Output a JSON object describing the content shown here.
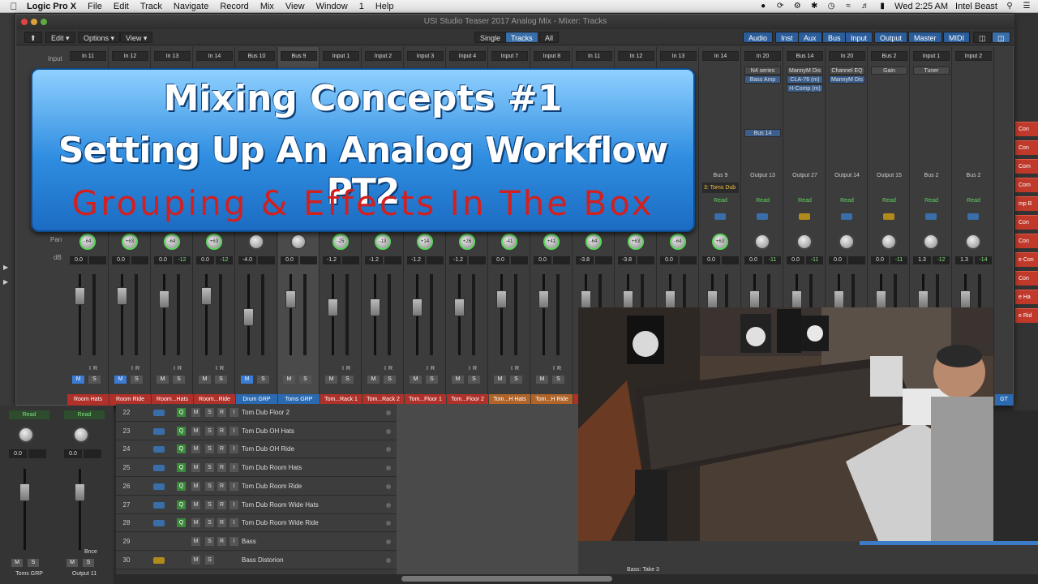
{
  "menubar": {
    "app": "Logic Pro X",
    "items": [
      "File",
      "Edit",
      "Track",
      "Navigate",
      "Record",
      "Mix",
      "View",
      "Window",
      "1",
      "Help"
    ],
    "clock": "Wed 2:25 AM",
    "user": "Intel Beast"
  },
  "window": {
    "title": "USI Studio Teaser 2017 Analog Mix - Mixer: Tracks"
  },
  "toolbar": {
    "edit": "Edit",
    "options": "Options",
    "view": "View",
    "single": "Single",
    "tracks": "Tracks",
    "all": "All",
    "filters": [
      "Audio",
      "Inst",
      "Aux",
      "Bus",
      "Input",
      "Output",
      "Master",
      "MIDI"
    ]
  },
  "row_labels": {
    "input": "Input",
    "pan": "Pan",
    "db": "dB"
  },
  "strips": [
    {
      "input": "In 11",
      "pan": "-64",
      "db": "0.0",
      "peak": "",
      "name": "Room Hats",
      "color": "#b0312a",
      "mute": true,
      "ir": true
    },
    {
      "input": "In 12",
      "pan": "+63",
      "db": "0.0",
      "peak": "",
      "name": "Room Ride",
      "color": "#b0312a",
      "mute": true,
      "ir": true
    },
    {
      "input": "In 13",
      "pan": "-64",
      "db": "0.0",
      "peak": "-12",
      "name": "Room...Hats",
      "color": "#b0312a",
      "mute": false,
      "ir": true
    },
    {
      "input": "In 14",
      "pan": "+63",
      "db": "0.0",
      "peak": "-12",
      "name": "Room...Ride",
      "color": "#b0312a",
      "mute": false,
      "ir": true
    },
    {
      "input": "Bus 10",
      "pan": "",
      "db": "-4.0",
      "peak": "",
      "name": "Drum GRP",
      "color": "#2b69b0",
      "mute": true,
      "ir": false
    },
    {
      "input": "Bus 9",
      "pan": "",
      "db": "0.0",
      "peak": "",
      "name": "Toms GRP",
      "color": "#2b69b0",
      "mute": false,
      "ir": false
    },
    {
      "input": "Input 1",
      "pan": "-25",
      "db": "-1.2",
      "peak": "",
      "name": "Tom...Rack 1",
      "color": "#b0312a",
      "mute": false,
      "ir": true
    },
    {
      "input": "Input 2",
      "pan": "-13",
      "db": "-1.2",
      "peak": "",
      "name": "Tom...Rack 2",
      "color": "#b0312a",
      "mute": false,
      "ir": true
    },
    {
      "input": "Input 3",
      "pan": "+14",
      "db": "-1.2",
      "peak": "",
      "name": "Tom...Floor 1",
      "color": "#b0312a",
      "mute": false,
      "ir": true
    },
    {
      "input": "Input 4",
      "pan": "+26",
      "db": "-1.2",
      "peak": "",
      "name": "Tom...Floor 2",
      "color": "#b0312a",
      "mute": false,
      "ir": true
    },
    {
      "input": "Input 7",
      "pan": "-41",
      "db": "0.0",
      "peak": "",
      "name": "Tom...H Hats",
      "color": "#b0642a",
      "mute": false,
      "ir": true
    },
    {
      "input": "Input 8",
      "pan": "+41",
      "db": "0.0",
      "peak": "",
      "name": "Tom...H Ride",
      "color": "#b0642a",
      "mute": false,
      "ir": true
    },
    {
      "input": "In 11",
      "pan": "-64",
      "db": "-3.8",
      "peak": "",
      "name": "",
      "color": "#b0312a",
      "mute": false,
      "ir": true
    },
    {
      "input": "In 12",
      "pan": "+63",
      "db": "-3.8",
      "peak": "",
      "name": "",
      "color": "#b0312a",
      "mute": false,
      "ir": true
    },
    {
      "input": "In 13",
      "pan": "-64",
      "db": "0.0",
      "peak": "",
      "name": "",
      "color": "#b0312a",
      "mute": false,
      "ir": true
    },
    {
      "input": "In 14",
      "pan": "+63",
      "db": "0.0",
      "peak": "",
      "name": "",
      "color": "#b0312a",
      "mute": false,
      "ir": true,
      "bus": "Bus 9",
      "busy": "3: Toms Dub",
      "read": "Read"
    },
    {
      "input": "In 20",
      "pan": "",
      "db": "0.0",
      "peak": "-11",
      "name": "",
      "color": "#333333",
      "slots": [
        "N4 series",
        "Bass Amp"
      ],
      "bus": "Output 13",
      "read": "Read",
      "sendslot": "Bus 14"
    },
    {
      "input": "Bus 14",
      "pan": "",
      "db": "0.0",
      "peak": "-11",
      "name": "",
      "color": "#333333",
      "slots": [
        "MannyM Dis",
        "CLA-76 (m)",
        "H-Comp (m)"
      ],
      "bus": "Output 27",
      "read": "Read",
      "yellow": true
    },
    {
      "input": "In 20",
      "pan": "",
      "db": "0.0",
      "peak": "",
      "name": "",
      "color": "#333333",
      "slots": [
        "Channel EQ",
        "MannyM Dis"
      ],
      "bus": "Output 14",
      "read": "Read"
    },
    {
      "input": "Bus 2",
      "pan": "",
      "db": "0.0",
      "peak": "-11",
      "name": "",
      "color": "#333333",
      "slots": [
        "Gain"
      ],
      "bus": "Output 15",
      "read": "Read",
      "yellow": true
    },
    {
      "input": "Input 1",
      "pan": "",
      "db": "1.3",
      "peak": "-12",
      "name": "",
      "color": "#333333",
      "slots": [
        "Tuner"
      ],
      "bus": "Bus 2",
      "read": "Read"
    },
    {
      "input": "Input 2",
      "pan": "",
      "db": "1.3",
      "peak": "-14",
      "name": "",
      "color": "#333333",
      "bus": "Bus 2",
      "read": "Read"
    }
  ],
  "banner": {
    "line1": "Mixing Concepts #1",
    "line2": "Setting Up An Analog Workflow PT2",
    "line3": "Grouping & Effects In The Box"
  },
  "lower_strips": [
    {
      "read": "Read",
      "db": "0.0",
      "name": "Toms GRP",
      "bounce": ""
    },
    {
      "read": "Read",
      "db": "0.0",
      "name": "Output 11",
      "bounce": "Bnce"
    }
  ],
  "tracks": [
    {
      "num": "22",
      "name": "Tom Dub Floor 2",
      "q": true,
      "icon": "blue"
    },
    {
      "num": "23",
      "name": "Tom Dub OH Hats",
      "q": true,
      "icon": "blue"
    },
    {
      "num": "24",
      "name": "Tom Dub OH Ride",
      "q": true,
      "icon": "blue"
    },
    {
      "num": "25",
      "name": "Tom Dub Room Hats",
      "q": true,
      "icon": "blue"
    },
    {
      "num": "26",
      "name": "Tom Dub Room Ride",
      "q": true,
      "icon": "blue"
    },
    {
      "num": "27",
      "name": "Tom Dub Room Wide Hats",
      "q": true,
      "icon": "blue"
    },
    {
      "num": "28",
      "name": "Tom Dub Room Wide Ride",
      "q": true,
      "icon": "blue"
    },
    {
      "num": "29",
      "name": "Bass",
      "q": false,
      "icon": "none"
    },
    {
      "num": "30",
      "name": "Bass Distorion",
      "q": false,
      "icon": "yellow"
    }
  ],
  "track_buttons": [
    "M",
    "S",
    "R",
    "I"
  ],
  "region": {
    "take": "Bass: Take 3"
  },
  "right_segments": [
    "Con",
    "Con",
    "Con",
    "Com",
    "Com",
    "mp B",
    "Con",
    "Con",
    "e Con",
    "Con",
    "e Ha",
    "e Rid"
  ],
  "gt": "GT"
}
